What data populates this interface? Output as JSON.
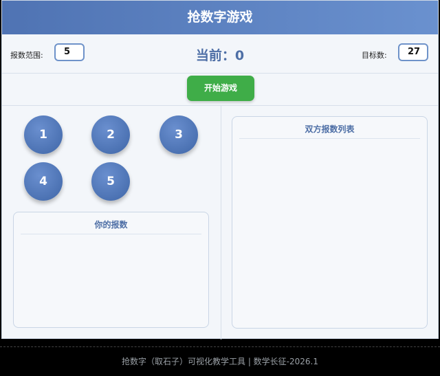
{
  "app": {
    "title": "抢数字游戏"
  },
  "controls": {
    "range_label": "报数范围:",
    "range_value": "5",
    "current_text": "当前：0",
    "target_label": "目标数:",
    "target_value": "27"
  },
  "start_button": "开始游戏",
  "number_buttons": [
    "1",
    "2",
    "3",
    "4",
    "5"
  ],
  "your_panel": {
    "title": "你的报数"
  },
  "list_panel": {
    "title": "双方报数列表"
  },
  "footer": {
    "text": "抢数字（取石子）可视化教学工具 | 数学长征-2026.1"
  },
  "colors": {
    "header": "#5b80c0",
    "start_button": "#3fad48",
    "number_button": "#4f76b8"
  }
}
